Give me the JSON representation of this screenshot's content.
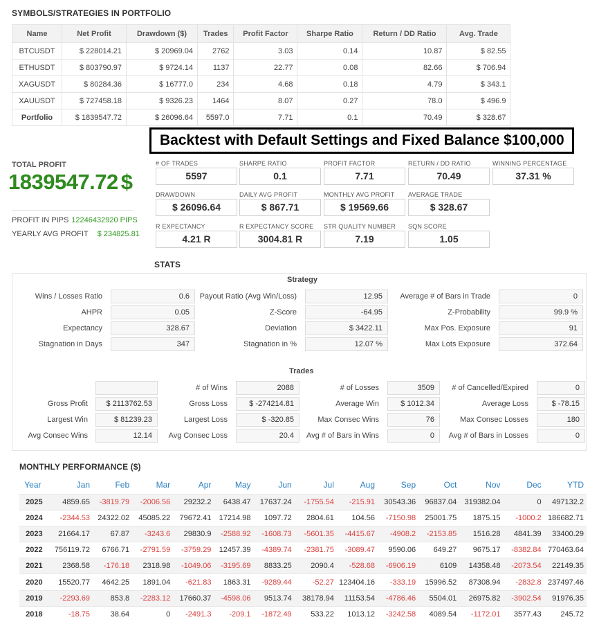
{
  "portfolio_section": {
    "title": "SYMBOLS/STRATEGIES IN PORTFOLIO",
    "columns": [
      "Name",
      "Net Profit",
      "Drawdown ($)",
      "Trades",
      "Profit Factor",
      "Sharpe Ratio",
      "Return / DD Ratio",
      "Avg. Trade"
    ],
    "rows": [
      [
        "BTCUSDT",
        "$ 228014.21",
        "$ 20969.04",
        "2762",
        "3.03",
        "0.14",
        "10.87",
        "$ 82.55"
      ],
      [
        "ETHUSDT",
        "$ 803790.97",
        "$ 9724.14",
        "1137",
        "22.77",
        "0.08",
        "82.66",
        "$ 706.94"
      ],
      [
        "XAGUSDT",
        "$ 80284.36",
        "$ 16777.0",
        "234",
        "4.68",
        "0.18",
        "4.79",
        "$ 343.1"
      ],
      [
        "XAUUSDT",
        "$ 727458.18",
        "$ 9326.23",
        "1464",
        "8.07",
        "0.27",
        "78.0",
        "$ 496.9"
      ],
      [
        "Portfolio",
        "$ 1839547.72",
        "$ 26096.64",
        "5597.0",
        "7.71",
        "0.1",
        "70.49",
        "$ 328.67"
      ]
    ]
  },
  "banner": "Backtest with Default Settings and Fixed Balance $100,000",
  "total_profit": {
    "label": "TOTAL PROFIT",
    "value": "1839547.72",
    "currency": "$",
    "pips_label": "PROFIT IN PIPS",
    "pips_value": "12246432920 PIPS",
    "yearly_label": "YEARLY AVG PROFIT",
    "yearly_value": "$ 234825.81"
  },
  "stats_boxes": [
    {
      "label": "# OF TRADES",
      "value": "5597"
    },
    {
      "label": "SHARPE RATIO",
      "value": "0.1"
    },
    {
      "label": "PROFIT FACTOR",
      "value": "7.71"
    },
    {
      "label": "RETURN / DD RATIO",
      "value": "70.49"
    },
    {
      "label": "WINNING PERCENTAGE",
      "value": "37.31 %"
    },
    {
      "label": "DRAWDOWN",
      "value": "$ 26096.64"
    },
    {
      "label": "DAILY AVG PROFIT",
      "value": "$ 867.71"
    },
    {
      "label": "MONTHLY AVG PROFIT",
      "value": "$ 19569.66"
    },
    {
      "label": "AVERAGE TRADE",
      "value": "$ 328.67"
    },
    {
      "label": "R EXPECTANCY",
      "value": "4.21 R"
    },
    {
      "label": "R EXPECTANCY SCORE",
      "value": "3004.81 R"
    },
    {
      "label": "STR QUALITY NUMBER",
      "value": "7.19"
    },
    {
      "label": "SQN SCORE",
      "value": "1.05"
    }
  ],
  "stats": {
    "title": "STATS",
    "strategy_title": "Strategy",
    "strategy_rows": [
      [
        [
          "Wins / Losses Ratio",
          "0.6"
        ],
        [
          "Payout Ratio (Avg Win/Loss)",
          "12.95"
        ],
        [
          "Average # of Bars in Trade",
          "0"
        ]
      ],
      [
        [
          "AHPR",
          "0.05"
        ],
        [
          "Z-Score",
          "-64.95"
        ],
        [
          "Z-Probability",
          "99.9 %"
        ]
      ],
      [
        [
          "Expectancy",
          "328.67"
        ],
        [
          "Deviation",
          "$ 3422.11"
        ],
        [
          "Max Pos. Exposure",
          "91"
        ]
      ],
      [
        [
          "Stagnation in Days",
          "347"
        ],
        [
          "Stagnation in %",
          "12.07 %"
        ],
        [
          "Max Lots Exposure",
          "372.64"
        ]
      ]
    ],
    "trades_title": "Trades",
    "trades_rows": [
      [
        [
          "",
          ""
        ],
        [
          "# of Wins",
          "2088"
        ],
        [
          "# of Losses",
          "3509"
        ],
        [
          "# of Cancelled/Expired",
          "0"
        ]
      ],
      [
        [
          "Gross Profit",
          "$ 2113762.53"
        ],
        [
          "Gross Loss",
          "$ -274214.81"
        ],
        [
          "Average Win",
          "$ 1012.34"
        ],
        [
          "Average Loss",
          "$ -78.15"
        ]
      ],
      [
        [
          "Largest Win",
          "$ 81239.23"
        ],
        [
          "Largest Loss",
          "$ -320.85"
        ],
        [
          "Max Consec Wins",
          "76"
        ],
        [
          "Max Consec Losses",
          "180"
        ]
      ],
      [
        [
          "Avg Consec Wins",
          "12.14"
        ],
        [
          "Avg Consec Loss",
          "20.4"
        ],
        [
          "Avg # of Bars in Wins",
          "0"
        ],
        [
          "Avg # of Bars in Losses",
          "0"
        ]
      ]
    ]
  },
  "monthly": {
    "title": "MONTHLY PERFORMANCE ($)",
    "columns": [
      "Year",
      "Jan",
      "Feb",
      "Mar",
      "Apr",
      "May",
      "Jun",
      "Jul",
      "Aug",
      "Sep",
      "Oct",
      "Nov",
      "Dec",
      "YTD"
    ],
    "rows": [
      [
        "2025",
        "4859.65",
        "-3819.79",
        "-2006.56",
        "29232.2",
        "6438.47",
        "17637.24",
        "-1755.54",
        "-215.91",
        "30543.36",
        "96837.04",
        "319382.04",
        "0",
        "497132.2"
      ],
      [
        "2024",
        "-2344.53",
        "24322.02",
        "45085.22",
        "79672.41",
        "17214.98",
        "1097.72",
        "2804.61",
        "104.56",
        "-7150.98",
        "25001.75",
        "1875.15",
        "-1000.2",
        "186682.71"
      ],
      [
        "2023",
        "21664.17",
        "67.87",
        "-3243.6",
        "29830.9",
        "-2588.92",
        "-1608.73",
        "-5601.35",
        "-4415.67",
        "-4908.2",
        "-2153.85",
        "1516.28",
        "4841.39",
        "33400.29"
      ],
      [
        "2022",
        "756119.72",
        "6766.71",
        "-2791.59",
        "-3759.29",
        "12457.39",
        "-4389.74",
        "-2381.75",
        "-3089.47",
        "9590.06",
        "649.27",
        "9675.17",
        "-8382.84",
        "770463.64"
      ],
      [
        "2021",
        "2368.58",
        "-176.18",
        "2318.98",
        "-1049.06",
        "-3195.69",
        "8833.25",
        "2090.4",
        "-528.68",
        "-6906.19",
        "6109",
        "14358.48",
        "-2073.54",
        "22149.35"
      ],
      [
        "2020",
        "15520.77",
        "4642.25",
        "1891.04",
        "-621.83",
        "1863.31",
        "-9289.44",
        "-52.27",
        "123404.16",
        "-333.19",
        "15996.52",
        "87308.94",
        "-2832.8",
        "237497.46"
      ],
      [
        "2019",
        "-2293.69",
        "853.8",
        "-2283.12",
        "17660.37",
        "-4598.06",
        "9513.74",
        "38178.94",
        "11153.54",
        "-4786.46",
        "5504.01",
        "26975.82",
        "-3902.54",
        "91976.35"
      ],
      [
        "2018",
        "-18.75",
        "38.64",
        "0",
        "-2491.3",
        "-209.1",
        "-1872.49",
        "533.22",
        "1013.12",
        "-3242.58",
        "4089.54",
        "-1172.01",
        "3577.43",
        "245.72"
      ]
    ]
  },
  "colors": {
    "profit_green": "#2e8b1e",
    "negative_red": "#d9413f",
    "header_blue": "#2a7fc1"
  }
}
